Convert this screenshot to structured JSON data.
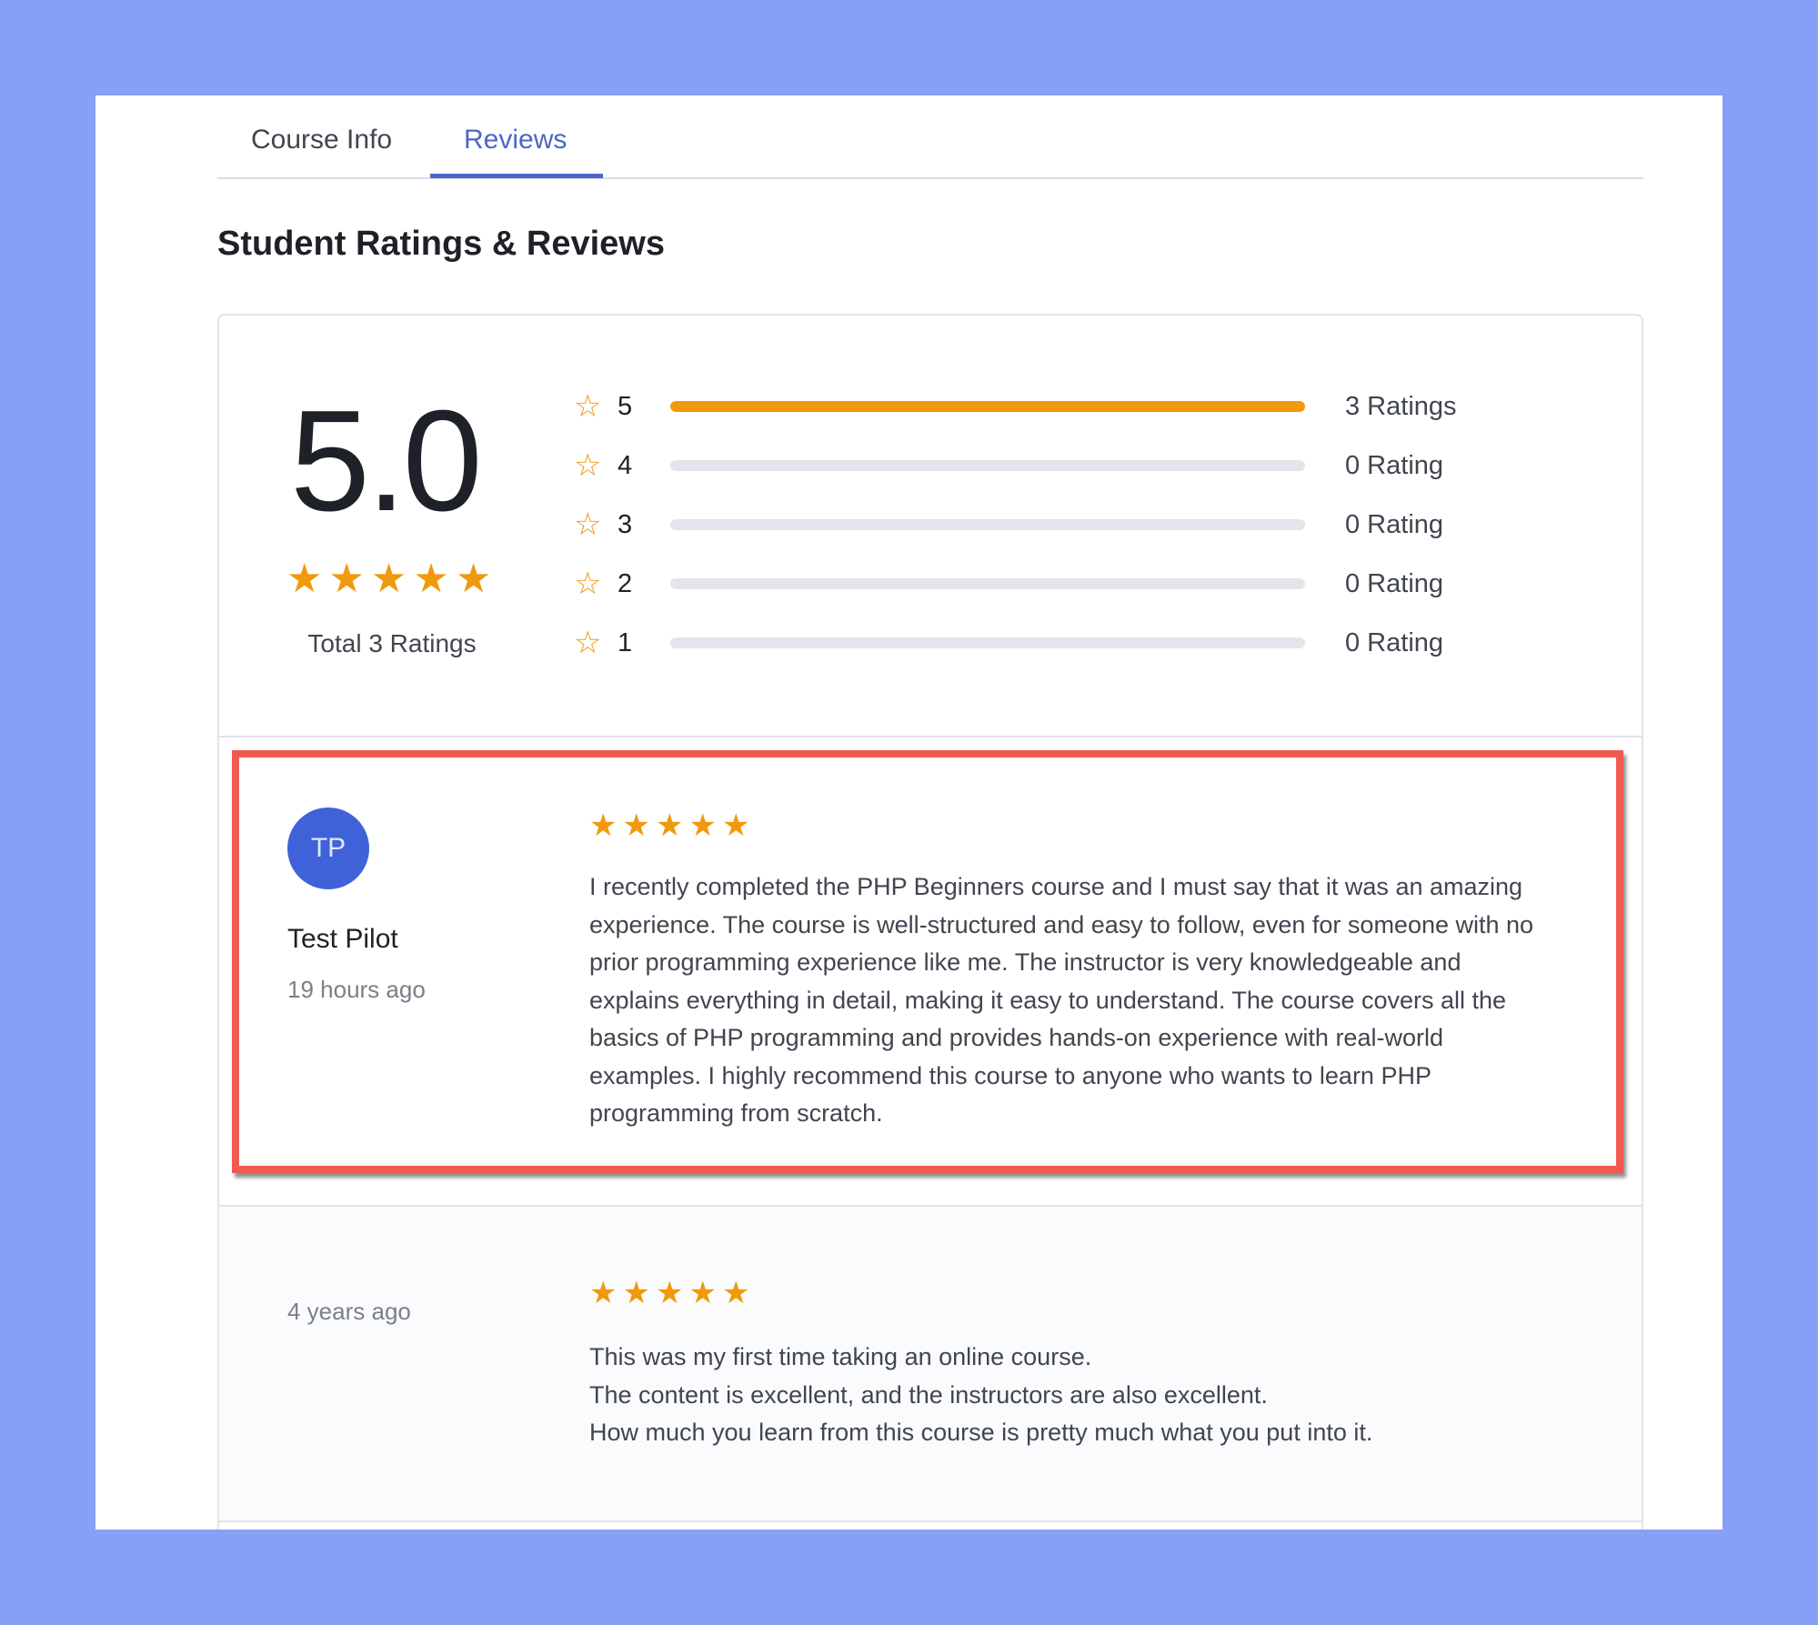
{
  "tabs": [
    {
      "label": "Course Info",
      "active": false
    },
    {
      "label": "Reviews",
      "active": true
    }
  ],
  "heading": "Student Ratings & Reviews",
  "summary": {
    "average": "5.0",
    "average_stars": 5,
    "total_label": "Total 3 Ratings",
    "breakdown": [
      {
        "stars": "5",
        "count_label": "3 Ratings",
        "fraction": 1.0
      },
      {
        "stars": "4",
        "count_label": "0 Rating",
        "fraction": 0
      },
      {
        "stars": "3",
        "count_label": "0 Rating",
        "fraction": 0
      },
      {
        "stars": "2",
        "count_label": "0 Rating",
        "fraction": 0
      },
      {
        "stars": "1",
        "count_label": "0 Rating",
        "fraction": 0
      }
    ]
  },
  "reviews": [
    {
      "initials": "TP",
      "name": "Test Pilot",
      "time": "19 hours ago",
      "rating": 5,
      "text": "I recently completed the PHP Beginners course and I must say that it was an amazing experience. The course is well-structured and easy to follow, even for someone with no prior programming experience like me. The instructor is very knowledgeable and explains everything in detail, making it easy to understand. The course covers all the basics of PHP programming and provides hands-on experience with real-world examples. I highly recommend this course to anyone who wants to learn PHP programming from scratch."
    },
    {
      "time": "4 years ago",
      "rating": 5,
      "lines": [
        "This was my first time taking an online course.",
        "The content is excellent, and the instructors are also excellent.",
        "How much you learn from this course is pretty much what you put into it."
      ]
    }
  ],
  "colors": {
    "background": "#87a0f5",
    "accent": "#4a67c9",
    "star": "#f0990d",
    "highlight": "#f05a50",
    "avatar": "#3f62d9"
  }
}
